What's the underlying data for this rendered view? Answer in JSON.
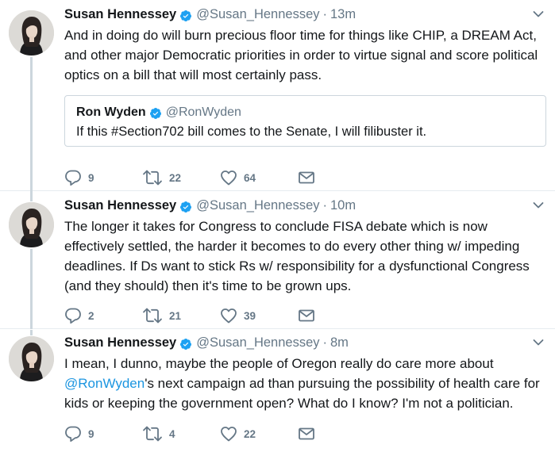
{
  "colors": {
    "accent": "#1b95e0",
    "verified": "#1da1f2",
    "muted": "#657786",
    "divider": "#e6ecf0"
  },
  "icons": {
    "reply": "reply-icon",
    "retweet": "retweet-icon",
    "like": "heart-icon",
    "dm": "envelope-icon",
    "verified": "verified-badge-icon",
    "more": "chevron-down-icon"
  },
  "tweets": [
    {
      "name": "Susan Hennessey",
      "handle": "@Susan_Hennessey",
      "dot": "·",
      "time": "13m",
      "text": "And in doing do will burn precious floor time for things like CHIP, a DREAM Act, and other major Democratic priorities in order to virtue signal and score political optics on a bill that will most certainly pass.",
      "quote": {
        "name": "Ron Wyden",
        "handle": "@RonWyden",
        "text": "If this #Section702 bill comes to the Senate, I will filibuster it."
      },
      "replies": "9",
      "retweets": "22",
      "likes": "64"
    },
    {
      "name": "Susan Hennessey",
      "handle": "@Susan_Hennessey",
      "dot": "·",
      "time": "10m",
      "text": "The longer it takes for Congress to conclude FISA debate which is now effectively settled, the harder it becomes to do every other thing w/ impeding deadlines. If Ds want to stick Rs w/ responsibility for a dysfunctional Congress (and they should) then it's time to be grown ups.",
      "replies": "2",
      "retweets": "21",
      "likes": "39"
    },
    {
      "name": "Susan Hennessey",
      "handle": "@Susan_Hennessey",
      "dot": "·",
      "time": "8m",
      "text_before": "I mean, I dunno, maybe the people of Oregon really do care more about ",
      "mention": "@RonWyden",
      "text_after": "'s next campaign ad than pursuing the possibility of health care for kids or keeping the government open? What do I know? I'm not a politician.",
      "replies": "9",
      "retweets": "4",
      "likes": "22"
    }
  ]
}
